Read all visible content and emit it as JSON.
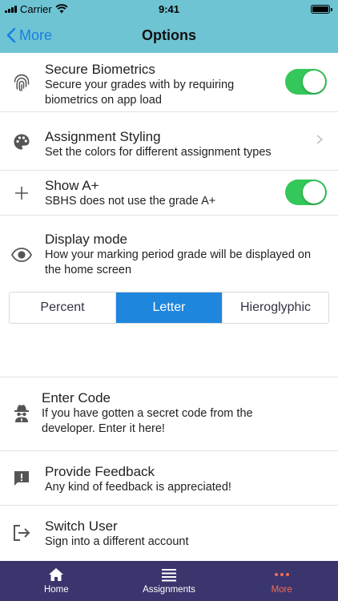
{
  "status_bar": {
    "carrier": "Carrier",
    "time": "9:41"
  },
  "nav": {
    "back_label": "More",
    "title": "Options"
  },
  "options": [
    {
      "title": "Secure Biometrics",
      "subtitle": "Secure your grades with by requiring biometrics on app load",
      "icon": "fingerprint-icon",
      "toggle_on": true
    },
    {
      "title": "Assignment Styling",
      "subtitle": "Set the colors for different assignment types",
      "icon": "palette-icon"
    },
    {
      "title": "Show A+",
      "subtitle": "SBHS does not use the grade A+",
      "icon": "plus-icon",
      "toggle_on": true
    },
    {
      "title": "Display mode",
      "subtitle": "How your marking period grade will be displayed on the home screen",
      "icon": "eye-icon"
    }
  ],
  "display_mode": {
    "options": [
      "Percent",
      "Letter",
      "Hieroglyphic"
    ],
    "selected": "Letter"
  },
  "extras": [
    {
      "title": "Enter Code",
      "subtitle": "If you have gotten a secret code from the developer. Enter it here!",
      "icon": "spy-icon"
    },
    {
      "title": "Provide Feedback",
      "subtitle": "Any kind of feedback is appreciated!",
      "icon": "feedback-icon"
    },
    {
      "title": "Switch User",
      "subtitle": "Sign into a different account",
      "icon": "sign-out-icon"
    }
  ],
  "tab_bar": {
    "tabs": [
      {
        "label": "Home",
        "icon": "home-icon"
      },
      {
        "label": "Assignments",
        "icon": "list-icon"
      },
      {
        "label": "More",
        "icon": "more-icon"
      }
    ],
    "active": "More"
  },
  "colors": {
    "header": "#6fc4d4",
    "accent_blue": "#1f86de",
    "toggle_on": "#34c759",
    "tab_bar": "#3b356e",
    "tab_active": "#f26d52"
  }
}
